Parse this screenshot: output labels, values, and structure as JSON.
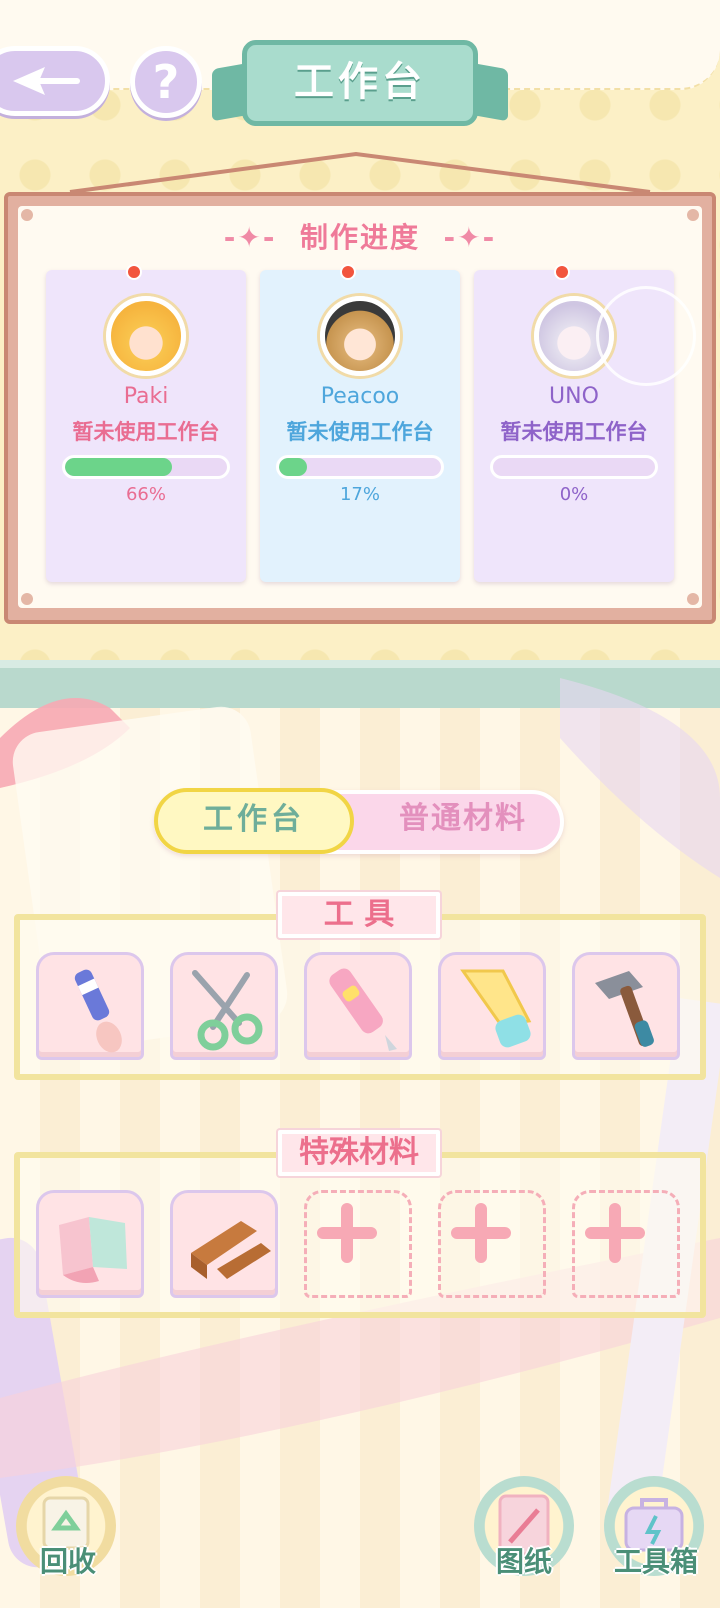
{
  "header": {
    "title": "工作台",
    "help_label": "?"
  },
  "progress": {
    "title": "制作进度",
    "cards": [
      {
        "name": "Paki",
        "status": "暂未使用工作台",
        "percent_label": "66%",
        "progress": 0.66,
        "color": "#e96d92",
        "bg": "#efe5fb"
      },
      {
        "name": "Peacoo",
        "status": "暂未使用工作台",
        "percent_label": "17%",
        "progress": 0.17,
        "color": "#4ea6dc",
        "bg": "#e2f2fd"
      },
      {
        "name": "UNO",
        "status": "暂未使用工作台",
        "percent_label": "0%",
        "progress": 0,
        "color": "#8e63c9",
        "bg": "#efe5fb"
      }
    ]
  },
  "tabs": {
    "active": "工作台",
    "inactive": "普通材料"
  },
  "tools": {
    "label": "工 具",
    "items": [
      "paintbrush-icon",
      "scissors-icon",
      "utility-knife-icon",
      "saw-icon",
      "hammer-icon"
    ]
  },
  "special": {
    "label": "特殊材料",
    "items": [
      "fabric-icon",
      "wood-planks-icon",
      "add-slot",
      "add-slot",
      "add-slot"
    ]
  },
  "bottom": {
    "recycle_label": "回收",
    "blueprint_label": "图纸",
    "toolbox_label": "工具箱"
  }
}
